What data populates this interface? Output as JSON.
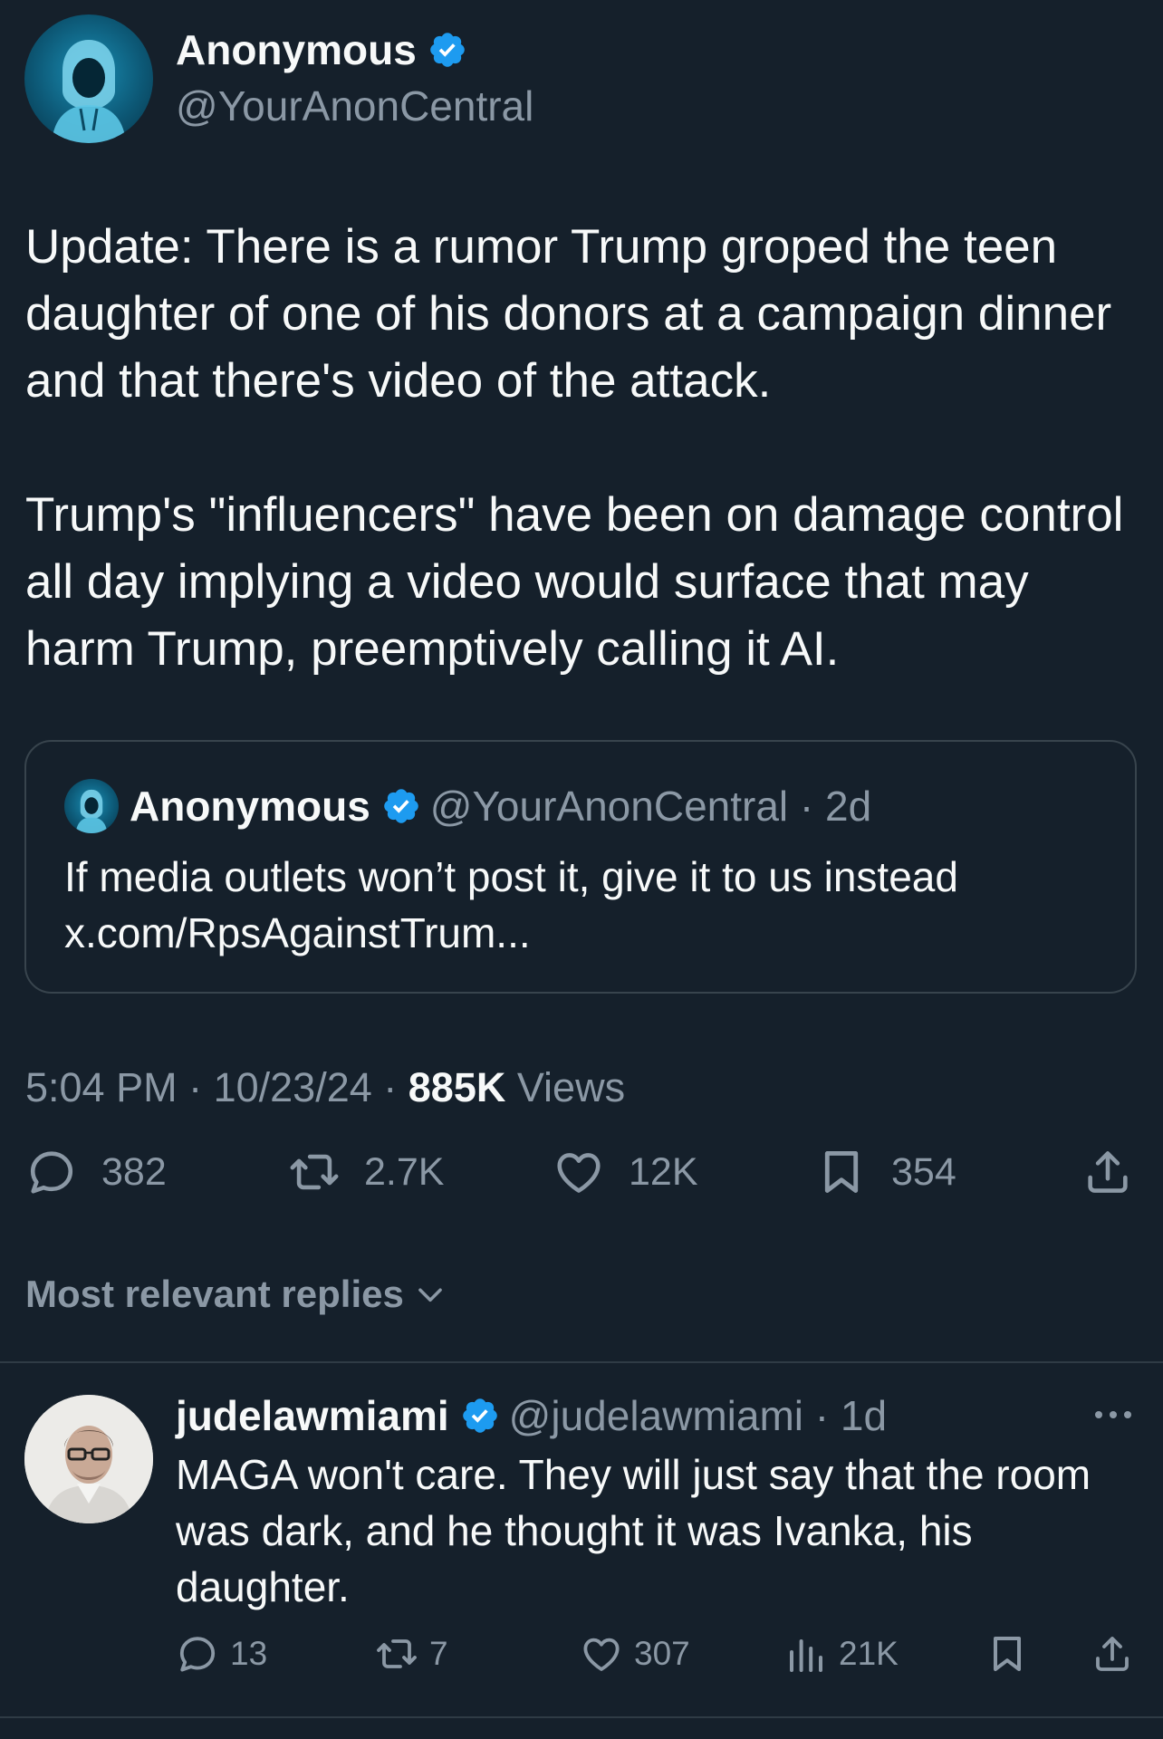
{
  "colors": {
    "background": "#15202b",
    "text": "#f7f9f9",
    "secondary": "#8b98a5",
    "verified": "#1d9bf0",
    "border": "#38444d"
  },
  "tweet": {
    "author_name": "Anonymous",
    "author_handle": "@YourAnonCentral",
    "verified_icon": "verified-badge-icon",
    "paragraph_1": "Update: There is a rumor Trump groped the teen daughter of one of his donors at a campaign dinner and that there's video of the attack.",
    "paragraph_2": "Trump's \"influencers\" have been on damage control all day implying a video would surface that may harm Trump, preemptively calling it AI.",
    "quote": {
      "author_name": "Anonymous",
      "author_handle": "@YourAnonCentral",
      "age": "2d",
      "line_1": "If media outlets won’t post it, give it to us instead",
      "line_2": "x.com/RpsAgainstTrum..."
    },
    "time": "5:04 PM",
    "date": "10/23/24",
    "views_count": "885K",
    "views_label": "Views",
    "actions": {
      "replies": "382",
      "reposts": "2.7K",
      "likes": "12K",
      "bookmarks": "354"
    }
  },
  "replies_filter": "Most relevant replies",
  "reply": {
    "author_name": "judelawmiami",
    "author_handle": "@judelawmiami",
    "age": "1d",
    "text": "MAGA won't care. They will just say that the room was dark, and he thought it was Ivanka, his daughter.",
    "actions": {
      "replies": "13",
      "reposts": "7",
      "likes": "307",
      "views": "21K"
    }
  }
}
